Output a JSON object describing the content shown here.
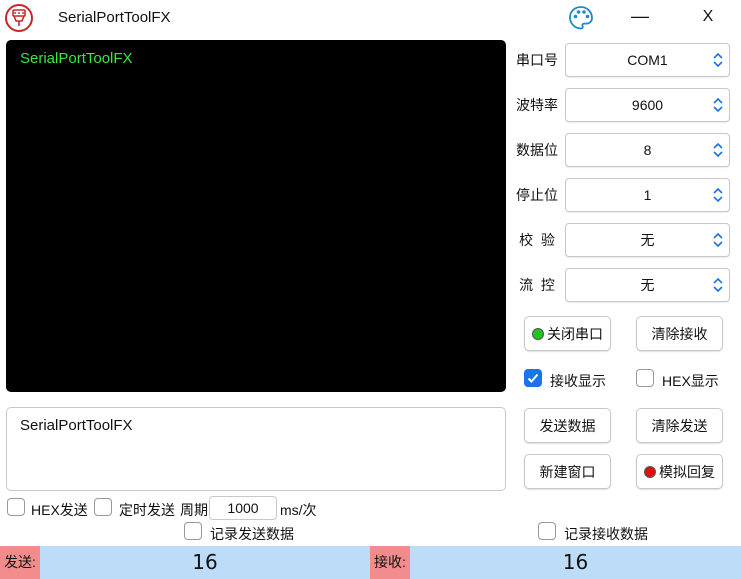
{
  "title_bar": {
    "title": "SerialPortToolFX",
    "minimize": "—",
    "close": "X"
  },
  "receive": {
    "text": "SerialPortToolFX",
    "text_color": "#39e83b"
  },
  "send": {
    "text": "SerialPortToolFX"
  },
  "settings": {
    "port": {
      "label": "串口号",
      "value": "COM1"
    },
    "baud": {
      "label": "波特率",
      "value": "9600"
    },
    "data": {
      "label": "数据位",
      "value": "8"
    },
    "stop": {
      "label": "停止位",
      "value": "1"
    },
    "parity": {
      "label": "校  验",
      "value": "无"
    },
    "flow": {
      "label": "流  控",
      "value": "无"
    }
  },
  "buttons": {
    "close_port": "关闭串口",
    "clear_receive": "清除接收",
    "send_data": "发送数据",
    "clear_send": "清除发送",
    "new_window": "新建窗口",
    "simulate_reply": "模拟回复"
  },
  "status_dots": {
    "close_port": "#22c322",
    "simulate_reply": "#e01010"
  },
  "options": {
    "receive_show": {
      "label": "接收显示",
      "checked": true
    },
    "hex_show": {
      "label": "HEX显示",
      "checked": false
    },
    "hex_send": {
      "label": "HEX发送",
      "checked": false
    },
    "timed_send": {
      "label": "定时发送",
      "checked": false
    },
    "period_label": "周期",
    "period_value": "1000",
    "period_unit": "ms/次",
    "log_send": {
      "label": "记录发送数据",
      "checked": false
    },
    "log_receive": {
      "label": "记录接收数据",
      "checked": false
    }
  },
  "status": {
    "send_label": "发送:",
    "send_count": "16",
    "receive_label": "接收:",
    "receive_count": "16",
    "bar_color": "#bcdcf8",
    "tag_color": "#f28b8b"
  },
  "icons": {
    "app": "serial-connector-icon",
    "theme": "palette-icon",
    "checked": "checkmark-icon"
  },
  "accent_color": "#1a73e8"
}
